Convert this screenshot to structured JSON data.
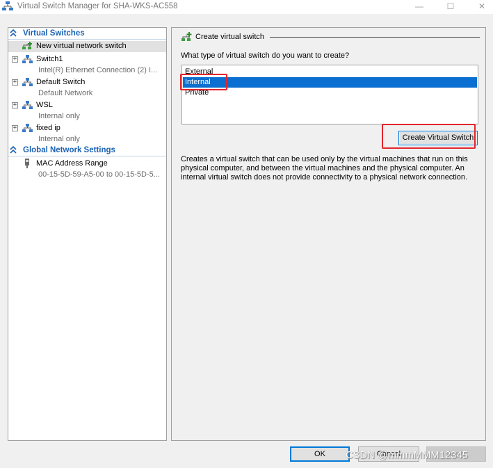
{
  "window": {
    "title": "Virtual Switch Manager for SHA-WKS-AC558",
    "icon": "virtual-switch-manager-icon",
    "controls": {
      "minimize": "—",
      "maximize": "☐",
      "close": "✕"
    }
  },
  "left_panel": {
    "virtual_switches_header": "Virtual Switches",
    "new_switch_label": "New virtual network switch",
    "switches": [
      {
        "name": "Switch1",
        "detail": "Intel(R) Ethernet Connection (2) I...",
        "expander": "+"
      },
      {
        "name": "Default Switch",
        "detail": "Default Network",
        "expander": "+"
      },
      {
        "name": "WSL",
        "detail": "Internal only",
        "expander": "+"
      },
      {
        "name": "fixed ip",
        "detail": "Internal only",
        "expander": "+"
      }
    ],
    "global_header": "Global Network Settings",
    "mac_range_label": "MAC Address Range",
    "mac_range_value": "00-15-5D-59-A5-00 to 00-15-5D-5..."
  },
  "right_panel": {
    "header": "Create virtual switch",
    "question": "What type of virtual switch do you want to create?",
    "options": [
      "External",
      "Internal",
      "Private"
    ],
    "selected_option": "Internal",
    "create_button": "Create Virtual Switch",
    "description": "Creates a virtual switch that can be used only by the virtual machines that run on this physical computer, and between the virtual machines and the physical computer. An internal virtual switch does not provide connectivity to a physical network connection."
  },
  "footer": {
    "ok": "OK",
    "cancel": "Cancel",
    "apply": "Apply"
  },
  "watermark": "CSDN @mmmMMM12345",
  "colors": {
    "accent": "#1b62b3",
    "selection": "#0a6fd0",
    "highlight": "#e2262b"
  }
}
